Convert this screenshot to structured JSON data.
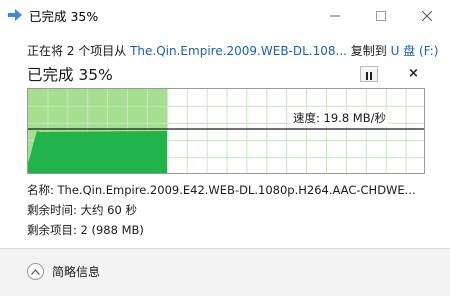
{
  "window": {
    "title": "已完成 35%",
    "minimize_icon": "minimize-icon",
    "maximize_icon": "maximize-icon",
    "close_icon": "close-icon"
  },
  "copy_status": {
    "prefix": "正在将 2 个项目从 ",
    "source": "The.Qin.Empire.2009.WEB-DL.108...",
    "middle": " 复制到 ",
    "destination": "U 盘 (F:)"
  },
  "progress": {
    "heading": "已完成 35%",
    "percent": 35,
    "pause_icon": "pause-icon",
    "cancel_label": "×"
  },
  "graph": {
    "speed_label": "速度: 19.8 MB/秒",
    "fill_color": "#22b34a",
    "completed_color": "#a5df90"
  },
  "details": {
    "name_label": "名称:",
    "name_value": "The.Qin.Empire.2009.E42.WEB-DL.1080p.H264.AAC-CHDWE...",
    "time_label": "剩余时间:",
    "time_value": "大约 60 秒",
    "items_label": "剩余项目:",
    "items_value": "2 (988 MB)"
  },
  "footer": {
    "toggle_icon": "chevron-up-icon",
    "toggle_label": "简略信息"
  }
}
